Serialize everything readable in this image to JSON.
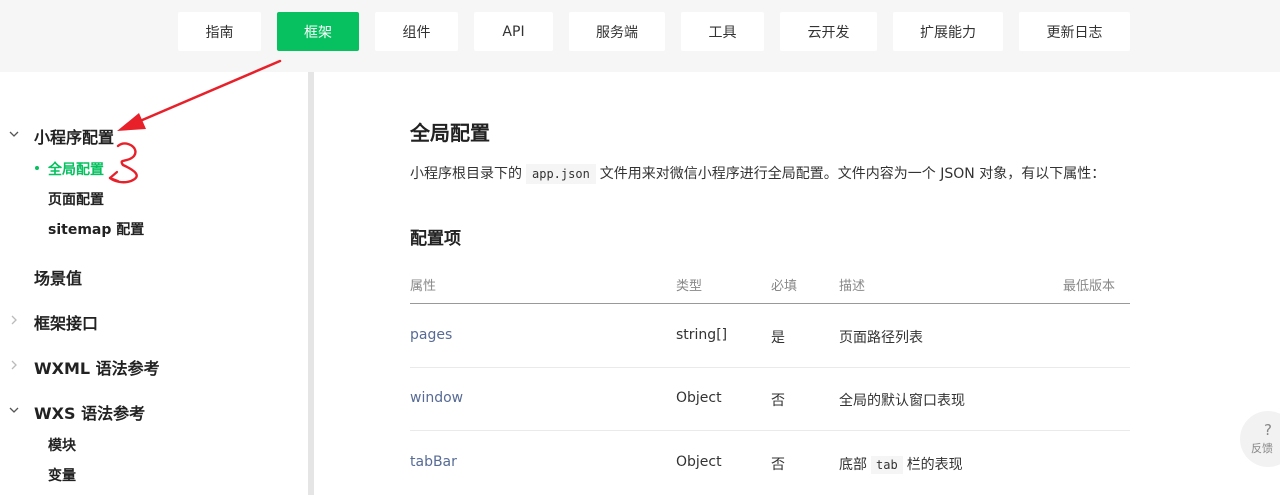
{
  "nav": {
    "items": [
      {
        "label": "指南"
      },
      {
        "label": "框架",
        "active": true
      },
      {
        "label": "组件"
      },
      {
        "label": "API"
      },
      {
        "label": "服务端"
      },
      {
        "label": "工具"
      },
      {
        "label": "云开发"
      },
      {
        "label": "扩展能力"
      },
      {
        "label": "更新日志"
      }
    ]
  },
  "sidebar": {
    "sections": [
      {
        "label": "小程序配置",
        "expanded": true,
        "children": [
          {
            "label": "全局配置",
            "active": true
          },
          {
            "label": "页面配置"
          },
          {
            "label": "sitemap 配置"
          }
        ]
      },
      {
        "label": "场景值"
      },
      {
        "label": "框架接口",
        "expanded": false
      },
      {
        "label": "WXML 语法参考",
        "expanded": false
      },
      {
        "label": "WXS 语法参考",
        "expanded": true,
        "children": [
          {
            "label": "模块"
          },
          {
            "label": "变量"
          }
        ]
      }
    ]
  },
  "main": {
    "title": "全局配置",
    "intro_before": "小程序根目录下的",
    "intro_code": "app.json",
    "intro_after": "文件用来对微信小程序进行全局配置。文件内容为一个 JSON 对象，有以下属性：",
    "section_title": "配置项",
    "table": {
      "headers": [
        "属性",
        "类型",
        "必填",
        "描述",
        "最低版本"
      ],
      "rows": [
        {
          "prop": "pages",
          "type": "string[]",
          "required": "是",
          "desc": "页面路径列表"
        },
        {
          "prop": "window",
          "type": "Object",
          "required": "否",
          "desc": "全局的默认窗口表现"
        },
        {
          "prop": "tabBar",
          "type": "Object",
          "required": "否",
          "desc_before": "底部",
          "desc_code": "tab",
          "desc_after": "栏的表现"
        }
      ]
    }
  },
  "feedback": {
    "icon": "?",
    "label": "反馈"
  },
  "colors": {
    "accent": "#07c160",
    "link": "#576b95",
    "annotation": "#e8202a"
  }
}
